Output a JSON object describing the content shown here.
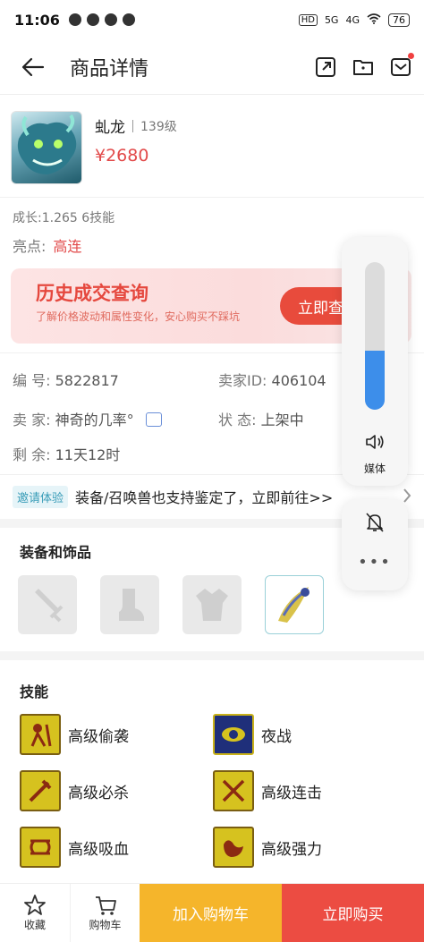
{
  "status_bar": {
    "time": "11:06",
    "network_tags": [
      "HD",
      "5G",
      "4G"
    ],
    "battery": "76"
  },
  "header": {
    "title": "商品详情"
  },
  "product": {
    "name": "虬龙",
    "level": "139级",
    "price": "¥2680"
  },
  "attrs": {
    "growth": "成长:1.265 6技能",
    "highlight_label": "亮点:",
    "highlight_value": "高连"
  },
  "banner": {
    "title": "历史成交查询",
    "subtitle": "了解价格波动和属性变化，安心购买不踩坑",
    "button": "立即查"
  },
  "details": {
    "code_label": "编  号:",
    "code_value": "5822817",
    "seller_id_label": "卖家ID:",
    "seller_id_value": "406104",
    "seller_label": "卖  家:",
    "seller_value": "神奇的几率°",
    "status_label": "状  态:",
    "status_value": "上架中",
    "remaining_label": "剩  余:",
    "remaining_value": "11天12时"
  },
  "invite": {
    "badge": "邀请体验",
    "text": "装备/召唤兽也支持鉴定了，立即前往>>"
  },
  "equipment": {
    "title": "装备和饰品",
    "slots": [
      "sword-icon",
      "boot-icon",
      "armor-icon",
      "ornament-icon"
    ]
  },
  "skills": {
    "title": "技能",
    "items": [
      "高级偷袭",
      "夜战",
      "高级必杀",
      "高级连击",
      "高级吸血",
      "高级强力"
    ]
  },
  "bottom_bar": {
    "favorite": "收藏",
    "cart": "购物车",
    "add_to_cart": "加入购物车",
    "buy_now": "立即购买"
  },
  "volume_overlay": {
    "label": "媒体",
    "level": 0.4
  },
  "colors": {
    "accent_red": "#e24a4a",
    "cart_yellow": "#f5b52b",
    "buy_red": "#ec4c42",
    "volume_blue": "#3d8eea"
  }
}
